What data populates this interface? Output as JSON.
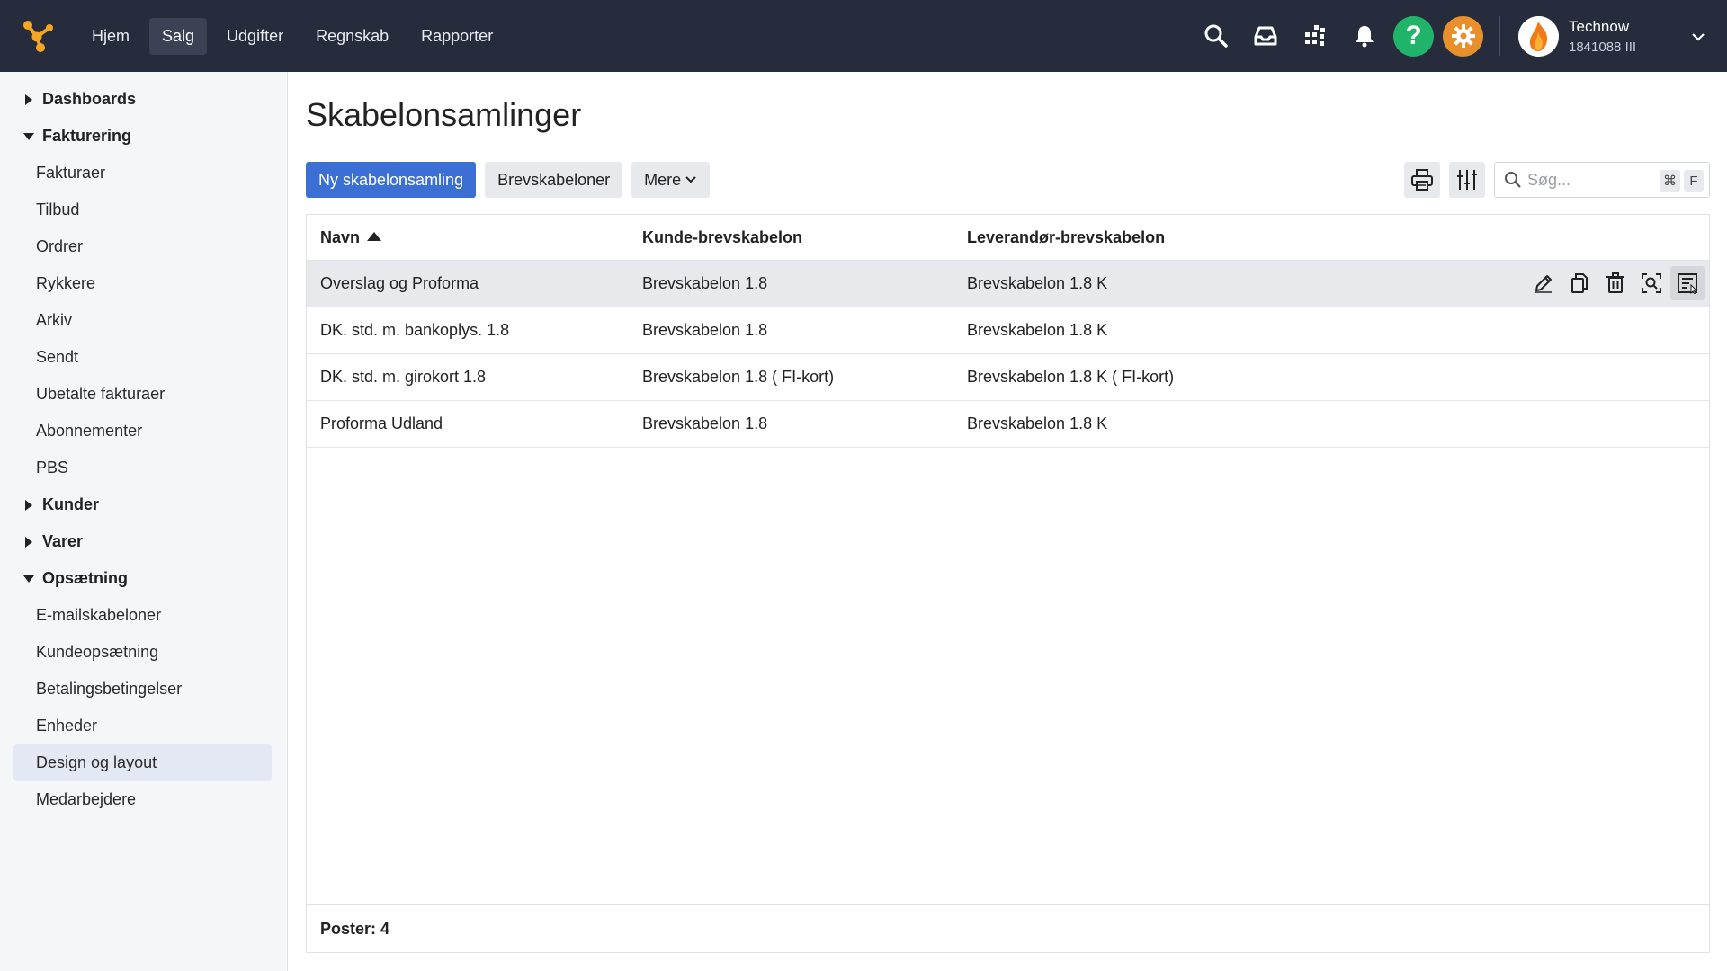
{
  "header": {
    "nav": [
      "Hjem",
      "Salg",
      "Udgifter",
      "Regnskab",
      "Rapporter"
    ],
    "active_nav": "Salg",
    "user": {
      "name": "Technow",
      "id": "1841088 III"
    }
  },
  "sidebar": {
    "groups": [
      {
        "label": "Dashboards",
        "expanded": false
      },
      {
        "label": "Fakturering",
        "expanded": true,
        "items": [
          "Fakturaer",
          "Tilbud",
          "Ordrer",
          "Rykkere",
          "Arkiv",
          "Sendt",
          "Ubetalte fakturaer",
          "Abonnementer",
          "PBS"
        ]
      },
      {
        "label": "Kunder",
        "expanded": false
      },
      {
        "label": "Varer",
        "expanded": false
      },
      {
        "label": "Opsætning",
        "expanded": true,
        "items": [
          "E-mailskabeloner",
          "Kundeopsætning",
          "Betalingsbetingelser",
          "Enheder",
          "Design og layout",
          "Medarbejdere"
        ]
      }
    ],
    "active_item": "Design og layout"
  },
  "main": {
    "title": "Skabelonsamlinger",
    "buttons": {
      "new": "Ny skabelonsamling",
      "letter_templates": "Brevskabeloner",
      "more": "Mere"
    },
    "search": {
      "placeholder": "Søg...",
      "kbd_mod": "⌘",
      "kbd_key": "F"
    },
    "table": {
      "columns": [
        "Navn",
        "Kunde-brevskabelon",
        "Leverandør-brevskabelon"
      ],
      "sort": {
        "column": "Navn",
        "direction": "asc"
      },
      "rows": [
        [
          "Overslag og Proforma",
          "Brevskabelon 1.8",
          "Brevskabelon 1.8 K"
        ],
        [
          "DK. std. m. bankoplys. 1.8",
          "Brevskabelon 1.8",
          "Brevskabelon 1.8 K"
        ],
        [
          "DK. std. m. girokort 1.8",
          "Brevskabelon 1.8 ( FI-kort)",
          "Brevskabelon 1.8 K ( FI-kort)"
        ],
        [
          "Proforma Udland",
          "Brevskabelon 1.8",
          "Brevskabelon 1.8 K"
        ]
      ],
      "footer": "Poster: 4"
    }
  },
  "colors": {
    "topbar": "#272c3d",
    "primary": "#3b6fd4",
    "help": "#20b46a",
    "settings": "#e98f2b"
  }
}
